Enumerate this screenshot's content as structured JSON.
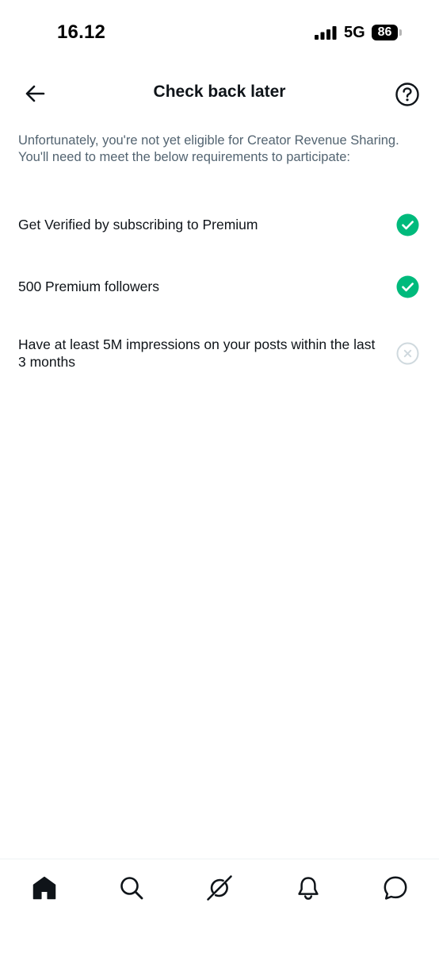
{
  "status_bar": {
    "time": "16.12",
    "network": "5G",
    "battery": "86"
  },
  "header": {
    "title": "Check back later",
    "back_icon": "arrow-left-icon",
    "help_icon": "question-circle-icon"
  },
  "intro_text": "Unfortunately, you're not yet eligible for Creator Revenue Sharing. You'll need to meet the below requirements to participate:",
  "requirements": [
    {
      "label": "Get Verified by subscribing to Premium",
      "met": true
    },
    {
      "label": "500 Premium followers",
      "met": true
    },
    {
      "label": "Have at least 5M impressions on your posts within the last 3 months",
      "met": false
    }
  ],
  "colors": {
    "met": "#00ba7c",
    "unmet": "#cfd9de",
    "secondary_text": "#536471",
    "primary_text": "#0f1419"
  },
  "bottom_nav": [
    {
      "name": "home",
      "icon": "home-icon"
    },
    {
      "name": "search",
      "icon": "search-icon"
    },
    {
      "name": "grok",
      "icon": "grok-icon"
    },
    {
      "name": "notifications",
      "icon": "bell-icon"
    },
    {
      "name": "messages",
      "icon": "message-icon"
    }
  ]
}
